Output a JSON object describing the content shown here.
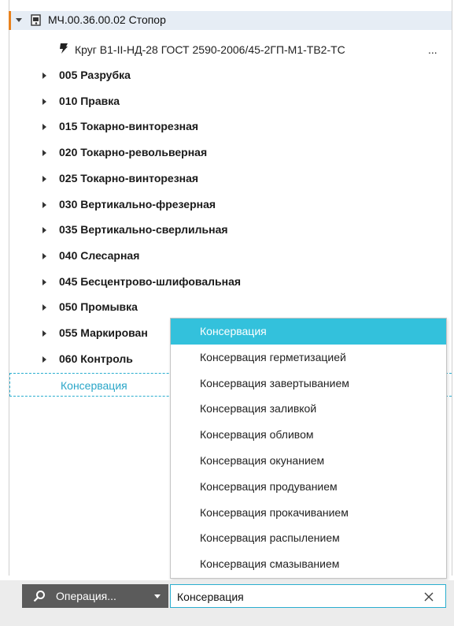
{
  "tree": {
    "root_label": "МЧ.00.36.00.02 Стопор",
    "material_label": "Круг В1-II-НД-28 ГОСТ 2590-2006/45-2ГП-М1-ТВ2-ТС",
    "material_ellipsis": "...",
    "operations": [
      {
        "label": "005 Разрубка"
      },
      {
        "label": "010 Правка"
      },
      {
        "label": "015 Токарно-винторезная"
      },
      {
        "label": "020 Токарно-револьверная"
      },
      {
        "label": "025 Токарно-винторезная"
      },
      {
        "label": "030 Вертикально-фрезерная"
      },
      {
        "label": "035 Вертикально-сверлильная"
      },
      {
        "label": "040 Слесарная"
      },
      {
        "label": "045 Бесцентрово-шлифовальная"
      },
      {
        "label": "050 Промывка"
      },
      {
        "label": "055 Маркирован"
      },
      {
        "label": "060 Контроль"
      }
    ],
    "new_item_label": "Консервация"
  },
  "dropdown": {
    "items": [
      {
        "label": "Консервация",
        "active": true
      },
      {
        "label": "Консервация герметизацией"
      },
      {
        "label": "Консервация завертыванием"
      },
      {
        "label": "Консервация заливкой"
      },
      {
        "label": "Консервация обливом"
      },
      {
        "label": "Консервация окунанием"
      },
      {
        "label": "Консервация продуванием"
      },
      {
        "label": "Консервация прокачиванием"
      },
      {
        "label": "Консервация распылением"
      },
      {
        "label": "Консервация смазыванием"
      }
    ]
  },
  "bottom": {
    "type_button_label": "Операция...",
    "search_value": "Консервация"
  },
  "colors": {
    "accent": "#33c1dc",
    "selection_marker": "#e8821e",
    "button_bg": "#5b5b5b"
  },
  "icons": {
    "root": "assembly-icon",
    "material": "material-icon",
    "search": "search-icon",
    "clear": "close-icon"
  }
}
